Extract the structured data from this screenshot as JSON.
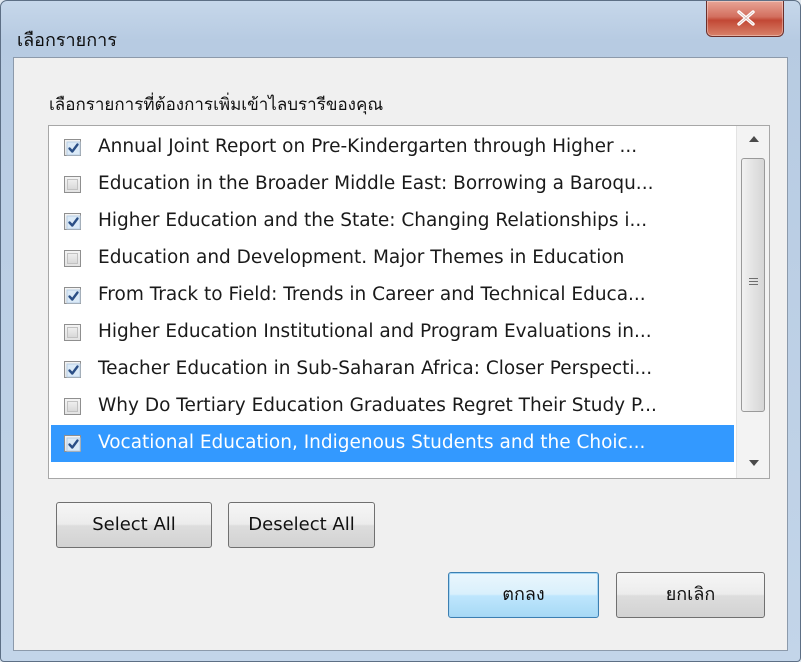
{
  "window": {
    "title": "เลือกรายการ",
    "close_icon": "close-x-icon"
  },
  "prompt": "เลือกรายการที่ต้องการเพิ่มเข้าไลบรารีของคุณ",
  "list": {
    "items": [
      {
        "label": "Annual Joint Report on Pre-Kindergarten through Higher ...",
        "checked": true,
        "selected": false
      },
      {
        "label": "Education in the Broader Middle East: Borrowing a Baroqu...",
        "checked": false,
        "selected": false
      },
      {
        "label": "Higher Education and the State: Changing Relationships i...",
        "checked": true,
        "selected": false
      },
      {
        "label": "Education and Development. Major Themes in Education",
        "checked": false,
        "selected": false
      },
      {
        "label": "From Track to Field: Trends in Career and Technical Educa...",
        "checked": true,
        "selected": false
      },
      {
        "label": "Higher Education Institutional and Program Evaluations in...",
        "checked": false,
        "selected": false
      },
      {
        "label": "Teacher Education in Sub-Saharan Africa: Closer Perspecti...",
        "checked": true,
        "selected": false
      },
      {
        "label": "Why Do Tertiary Education Graduates Regret Their Study P...",
        "checked": false,
        "selected": false
      },
      {
        "label": "Vocational Education, Indigenous Students and the Choic...",
        "checked": true,
        "selected": true
      }
    ]
  },
  "buttons": {
    "select_all": "Select All",
    "deselect_all": "Deselect All",
    "ok": "ตกลง",
    "cancel": "ยกเลิก"
  },
  "colors": {
    "selection": "#3399ff",
    "close_button": "#c24835",
    "default_button_border": "#3c7fb1"
  }
}
